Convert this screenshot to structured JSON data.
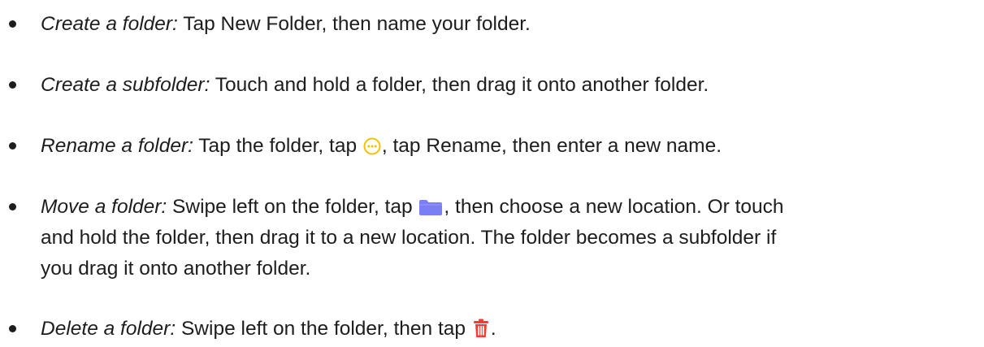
{
  "items": [
    {
      "term": "Create a folder:",
      "text": " Tap New Folder, then name your folder."
    },
    {
      "term": "Create a subfolder:",
      "text": " Touch and hold a folder, then drag it onto another folder."
    },
    {
      "term": "Rename a folder:",
      "before_icon": " Tap the folder, tap ",
      "icon": "more-ellipsis-circle-icon",
      "after_icon": ", tap Rename, then enter a new name."
    },
    {
      "term": "Move a folder:",
      "before_icon": " Swipe left on the folder, tap ",
      "icon": "folder-icon",
      "line1_rest": ", then choose a new location. Or touch",
      "line2": "and hold the folder, then drag it to a new location. The folder becomes a subfolder if",
      "line3": "you drag it onto another folder."
    },
    {
      "term": "Delete a folder:",
      "before_icon": " Swipe left on the folder, then tap ",
      "icon": "trash-icon",
      "after_icon": "."
    }
  ],
  "colors": {
    "text": "#1d1d1f",
    "ellipsis_icon": "#f2c200",
    "folder_icon": "#7b7ff5",
    "trash_icon": "#ff3b30"
  }
}
